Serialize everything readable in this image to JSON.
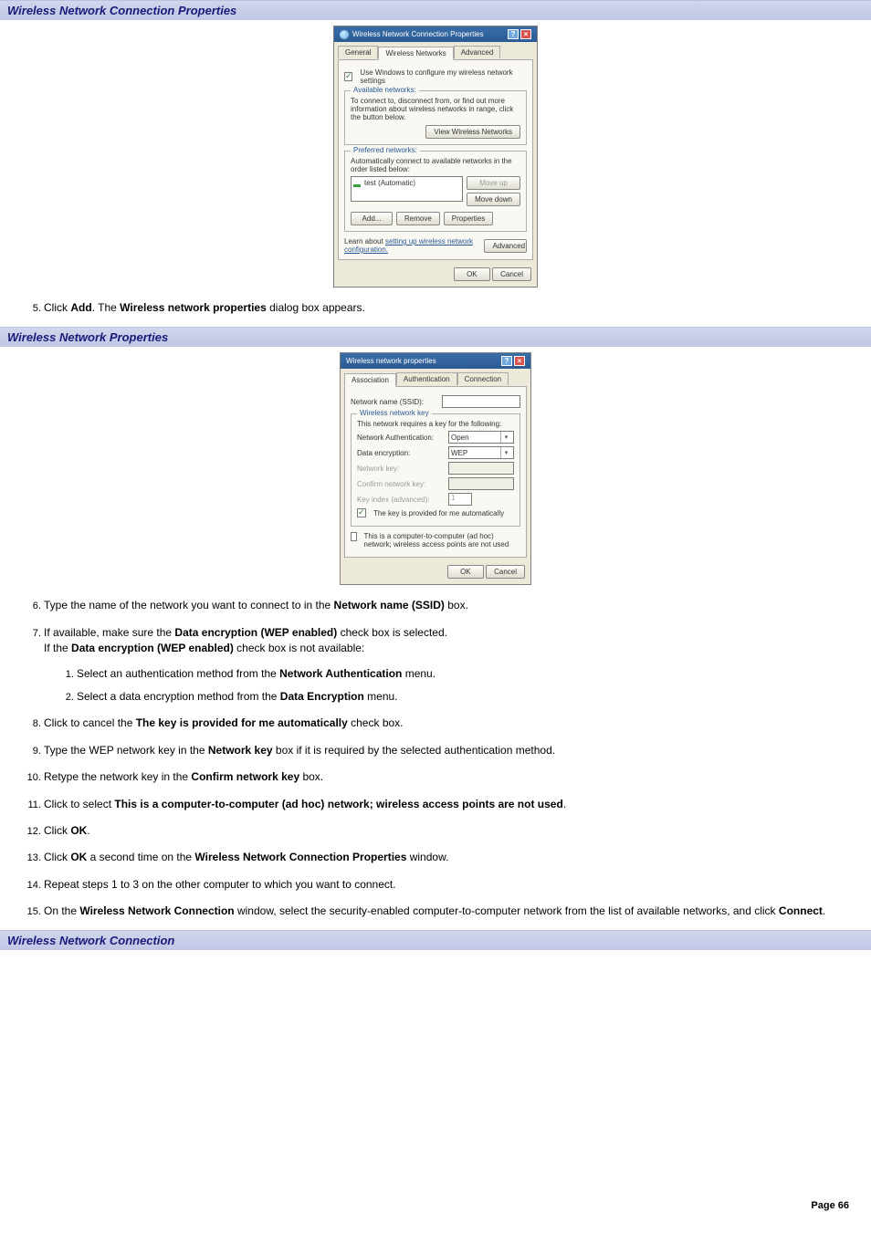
{
  "headings": {
    "h1": "Wireless Network Connection Properties",
    "h2": "Wireless Network Properties",
    "h3": "Wireless Network Connection"
  },
  "dialog1": {
    "title": "Wireless Network Connection Properties",
    "tabs": {
      "general": "General",
      "wireless": "Wireless Networks",
      "advanced": "Advanced"
    },
    "use_windows": "Use Windows to configure my wireless network settings",
    "available_legend": "Available networks:",
    "available_text": "To connect to, disconnect from, or find out more information about wireless networks in range, click the button below.",
    "view_btn": "View Wireless Networks",
    "preferred_legend": "Preferred networks:",
    "preferred_text": "Automatically connect to available networks in the order listed below:",
    "list_item": "test (Automatic)",
    "move_up": "Move up",
    "move_down": "Move down",
    "add": "Add...",
    "remove": "Remove",
    "properties": "Properties",
    "learn_pre": "Learn about ",
    "learn_link": "setting up wireless network configuration.",
    "advanced_btn": "Advanced",
    "ok": "OK",
    "cancel": "Cancel"
  },
  "dialog2": {
    "title": "Wireless network properties",
    "tabs": {
      "association": "Association",
      "authentication": "Authentication",
      "connection": "Connection"
    },
    "ssid_label": "Network name (SSID):",
    "key_legend": "Wireless network key",
    "key_intro": "This network requires a key for the following:",
    "auth_label": "Network Authentication:",
    "auth_value": "Open",
    "enc_label": "Data encryption:",
    "enc_value": "WEP",
    "netkey_label": "Network key:",
    "confirm_label": "Confirm network key:",
    "keyindex_label": "Key index (advanced):",
    "keyindex_value": "1",
    "auto_key": "The key is provided for me automatically",
    "adhoc": "This is a computer-to-computer (ad hoc) network; wireless access points are not used",
    "ok": "OK",
    "cancel": "Cancel"
  },
  "steps": {
    "s5a": "Click ",
    "s5b": "Add",
    "s5c": ". The ",
    "s5d": "Wireless network properties",
    "s5e": " dialog box appears.",
    "s6a": "Type the name of the network you want to connect to in the ",
    "s6b": "Network name (SSID)",
    "s6c": " box.",
    "s7a": "If available, make sure the ",
    "s7b": "Data encryption (WEP enabled)",
    "s7c": " check box is selected.",
    "s7d": "If the ",
    "s7e": "Data encryption (WEP enabled)",
    "s7f": " check box is not available:",
    "s7_1a": "Select an authentication method from the ",
    "s7_1b": "Network Authentication",
    "s7_1c": " menu.",
    "s7_2a": "Select a data encryption method from the ",
    "s7_2b": "Data Encryption",
    "s7_2c": " menu.",
    "s8a": "Click to cancel the ",
    "s8b": "The key is provided for me automatically",
    "s8c": " check box.",
    "s9a": "Type the WEP network key in the ",
    "s9b": "Network key",
    "s9c": " box if it is required by the selected authentication method.",
    "s10a": "Retype the network key in the ",
    "s10b": "Confirm network key",
    "s10c": " box.",
    "s11a": "Click to select ",
    "s11b": "This is a computer-to-computer (ad hoc) network; wireless access points are not used",
    "s11c": ".",
    "s12a": "Click ",
    "s12b": "OK",
    "s12c": ".",
    "s13a": "Click ",
    "s13b": "OK",
    "s13c": " a second time on the ",
    "s13d": "Wireless Network Connection Properties",
    "s13e": " window.",
    "s14": "Repeat steps 1 to 3 on the other computer to which you want to connect.",
    "s15a": "On the ",
    "s15b": "Wireless Network Connection",
    "s15c": " window, select the security-enabled computer-to-computer network from the list of available networks, and click ",
    "s15d": "Connect",
    "s15e": "."
  },
  "page": "Page 66"
}
